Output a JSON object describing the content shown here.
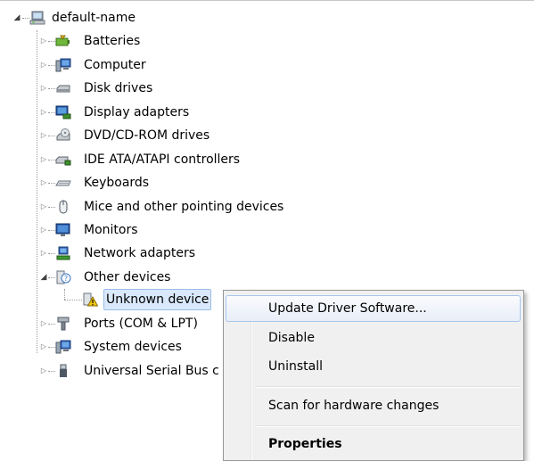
{
  "root": {
    "label": "default-name",
    "icon": "computer-root-icon"
  },
  "categories": [
    {
      "label": "Batteries",
      "icon": "battery-icon"
    },
    {
      "label": "Computer",
      "icon": "computer-icon"
    },
    {
      "label": "Disk drives",
      "icon": "disk-drive-icon"
    },
    {
      "label": "Display adapters",
      "icon": "display-adapter-icon"
    },
    {
      "label": "DVD/CD-ROM drives",
      "icon": "dvd-drive-icon"
    },
    {
      "label": "IDE ATA/ATAPI controllers",
      "icon": "ide-controller-icon"
    },
    {
      "label": "Keyboards",
      "icon": "keyboard-icon"
    },
    {
      "label": "Mice and other pointing devices",
      "icon": "mouse-icon"
    },
    {
      "label": "Monitors",
      "icon": "monitor-icon"
    },
    {
      "label": "Network adapters",
      "icon": "network-adapter-icon"
    },
    {
      "label": "Other devices",
      "icon": "other-devices-icon",
      "expanded": true
    },
    {
      "label": "Unknown device",
      "icon": "unknown-device-warning-icon",
      "child": true,
      "selected": true
    },
    {
      "label": "Ports (COM & LPT)",
      "icon": "port-icon"
    },
    {
      "label": "System devices",
      "icon": "system-devices-icon"
    },
    {
      "label": "Universal Serial Bus c",
      "icon": "usb-icon"
    }
  ],
  "context_menu": {
    "items": [
      {
        "label": "Update Driver Software...",
        "hover": true
      },
      {
        "label": "Disable"
      },
      {
        "label": "Uninstall"
      },
      {
        "label": "Scan for hardware changes"
      },
      {
        "label": "Properties",
        "bold": true
      }
    ]
  },
  "colors": {
    "selection_bg": "#d9e8fb",
    "menu_bg": "#f0f0f0",
    "menu_hover_border": "#a8c6ee",
    "warning": "#f2c811"
  }
}
